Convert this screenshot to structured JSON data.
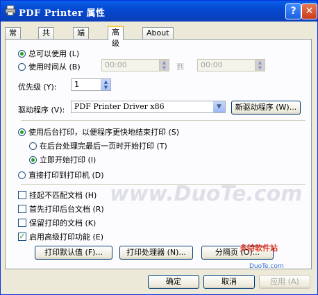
{
  "window": {
    "title": "PDF Printer 属性",
    "help_label": "?",
    "close_label": "✕",
    "icon": "printer-icon"
  },
  "tabs": [
    {
      "label": "常规"
    },
    {
      "label": "共享"
    },
    {
      "label": "端口"
    },
    {
      "label": "高级"
    },
    {
      "label": "About"
    }
  ],
  "active_tab": "高级",
  "availability": {
    "always_label": "总可以使用 (L)",
    "from_label": "使用时间从 (B)",
    "from_time": "00:00",
    "to_label": "到",
    "to_time": "00:00",
    "selected": "always"
  },
  "priority": {
    "label": "优先级 (Y):",
    "value": "1"
  },
  "driver": {
    "label": "驱动程序 (V):",
    "value": "PDF Printer Driver x86",
    "new_driver_button": "新驱动程序 (W)..."
  },
  "spooling": {
    "spool_label": "使用后台打印，以便程序更快地结束打印 (S)",
    "after_last_page_label": "在后台处理完最后一页时开始打印 (T)",
    "immediately_label": "立即开始打印 (I)",
    "direct_label": "直接打印到打印机 (D)"
  },
  "options": [
    {
      "label": "挂起不匹配文档 (H)",
      "checked": false
    },
    {
      "label": "首先打印后台文档 (R)",
      "checked": false
    },
    {
      "label": "保留打印的文档 (K)",
      "checked": false
    },
    {
      "label": "启用高级打印功能 (E)",
      "checked": true
    }
  ],
  "buttons_row": {
    "defaults": "打印默认值 (F)...",
    "processor": "打印处理器 (N)...",
    "separator": "分隔页 (O)..."
  },
  "dialog_buttons": {
    "ok": "确定",
    "cancel": "取消",
    "apply": "应用 (A)"
  },
  "watermark": "www.DuoTe.com",
  "logo": "多特软件站",
  "logo_sub": "DuoTe.com"
}
